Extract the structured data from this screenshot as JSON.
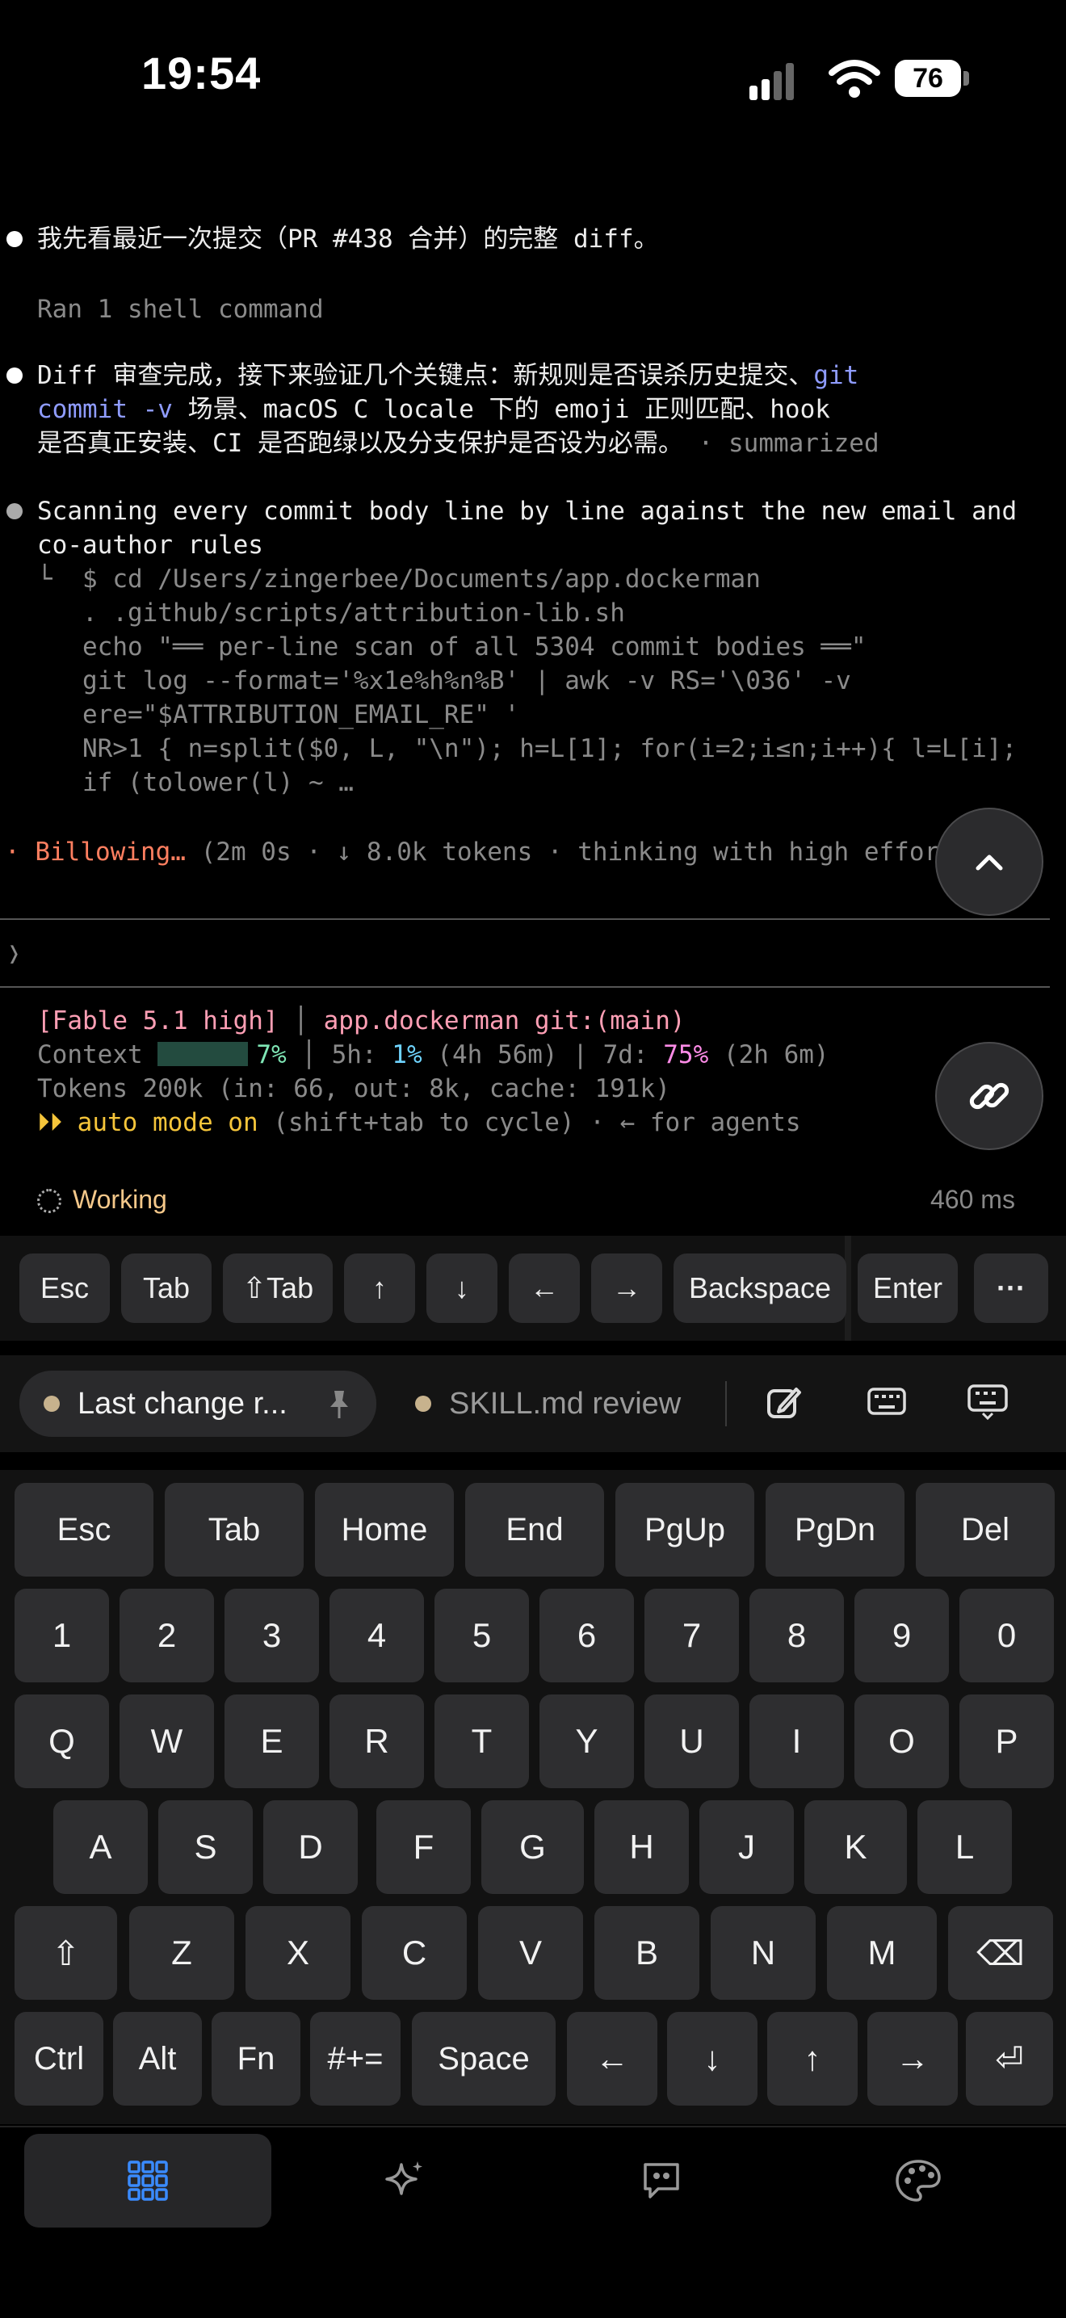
{
  "status_bar": {
    "time": "19:54",
    "battery": "76"
  },
  "terminal": {
    "line1": "我先看最近一次提交（PR #438 合并）的完整 diff。",
    "line2": "Ran 1 shell command",
    "line3a": "Diff 审查完成，接下来验证几个关键点：新规则是否误杀历史提交、",
    "line3a_kw": "git",
    "line3b_kw": "commit -v",
    "line3b": " 场景、macOS C locale 下的 emoji 正则匹配、hook",
    "line3c": "是否真正安装、CI 是否跑绿以及分支保护是否设为必需。",
    "line3c_tag": " · summarized",
    "line4a": "Scanning every commit body line by line against the new email and",
    "line4b": "co-author rules",
    "cmd1": "└  $ cd /Users/zingerbee/Documents/app.dockerman",
    "cmd2": "   . .github/scripts/attribution-lib.sh",
    "cmd3": "   echo \"══ per-line scan of all 5304 commit bodies ══\"",
    "cmd4": "   git log --format='%x1e%h%n%B' | awk -v RS='\\036' -v",
    "cmd5": "   ere=\"$ATTRIBUTION_EMAIL_RE\" '",
    "cmd6": "   NR>1 { n=split($0, L, \"\\n\"); h=L[1]; for(i=2;i≤n;i++){ l=L[i];",
    "cmd7": "   if (tolower(l) ~ …",
    "progress_word": "· Billowing…",
    "progress_rest": " (2m 0s · ↓ 8.0k tokens · thinking with high effort)",
    "prompt": "❭",
    "model": "[Fable 5.1 high]",
    "sep_bar": " │ ",
    "project": "app.dockerman git:(main)",
    "ctx_label": "Context ",
    "ctx_pct": "7%",
    "ctx_sep": " │ 5h: ",
    "h5_pct": "1%",
    "h5_rest": " (4h 56m) | 7d: ",
    "d7_pct": "75%",
    "d7_rest": " (2h 6m)",
    "tokens": "Tokens 200k (in: 66, out: 8k, cache: 191k)",
    "auto_mode": "⏵⏵ auto mode on",
    "auto_rest": " (shift+tab to cycle) · ← for agents",
    "working": "Working",
    "elapsed": "460 ms"
  },
  "toolbar_keys": [
    "Esc",
    "Tab",
    "⇧Tab",
    "↑",
    "↓",
    "←",
    "→",
    "Backspace",
    "Enter",
    "···"
  ],
  "sessions": {
    "active": "Last change r...",
    "inactive": "SKILL.md review"
  },
  "keyboard": {
    "row1": [
      "Esc",
      "Tab",
      "Home",
      "End",
      "PgUp",
      "PgDn",
      "Del"
    ],
    "row2": [
      "1",
      "2",
      "3",
      "4",
      "5",
      "6",
      "7",
      "8",
      "9",
      "0"
    ],
    "row3": [
      "Q",
      "W",
      "E",
      "R",
      "T",
      "Y",
      "U",
      "I",
      "O",
      "P"
    ],
    "row4": [
      "A",
      "S",
      "D",
      "F",
      "G",
      "H",
      "J",
      "K",
      "L"
    ],
    "row5": [
      "⇧",
      "Z",
      "X",
      "C",
      "V",
      "B",
      "N",
      "M",
      "⌫"
    ],
    "row6": [
      "Ctrl",
      "Alt",
      "Fn",
      "#+=",
      "Space",
      "←",
      "↓",
      "↑",
      "→",
      "⏎"
    ]
  },
  "colors": {
    "accent_blue": "#3a8bff",
    "orange": "#ff7f60",
    "yellow": "#f5c53a",
    "pink": "#ff9fb5"
  },
  "tabs": [
    "keyboard-grid-icon",
    "sparkle-icon",
    "chat-quote-icon",
    "palette-icon"
  ]
}
